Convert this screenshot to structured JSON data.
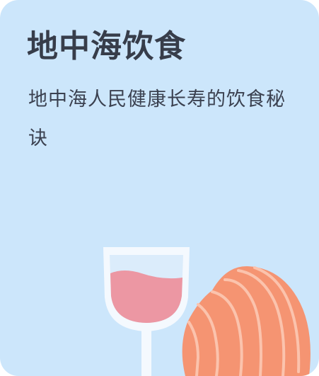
{
  "card": {
    "title": "地中海饮食",
    "description": "地中海人民健康长寿的饮食秘诀",
    "background_color": "#cce6fb"
  },
  "illustration": {
    "items": [
      "wine-glass-icon",
      "salmon-icon"
    ],
    "wine_color": "#ec97a3",
    "glass_color": "#f4f9fe",
    "salmon_color": "#f59472"
  }
}
